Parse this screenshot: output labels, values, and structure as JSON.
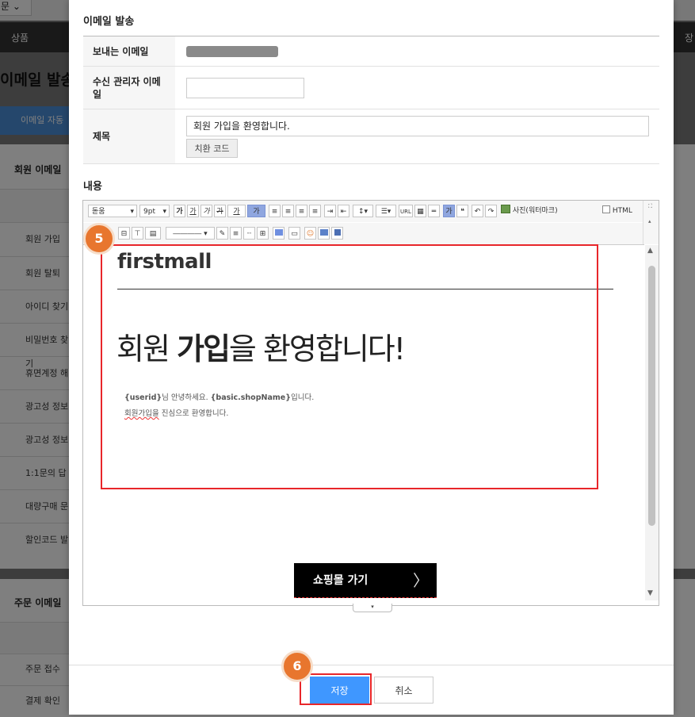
{
  "background": {
    "top_select": "문",
    "nav_left": "상품",
    "nav_right": "장",
    "page_title": "이메일 발송",
    "tab_label": "이메일 자동",
    "section1_title": "회원 이메일",
    "section1_rows": [
      "회원 가입",
      "회원 탈퇴",
      "아이디 찾기",
      "비밀번호 찾기",
      "휴면계정 해",
      "광고성 정보",
      "광고성 정보",
      "1:1문의 답",
      "대량구매 문",
      "할인코드 발"
    ],
    "section2_title": "주문 이메일",
    "section2_rows": [
      "주문 접수",
      "결제 확인"
    ]
  },
  "modal": {
    "title": "이메일 발송",
    "form": {
      "sender_label": "보내는 이메일",
      "recipient_label": "수신 관리자 이메일",
      "recipient_value": "",
      "subject_label": "제목",
      "subject_value": "회원 가입을 환영합니다.",
      "substitution_button": "치환 코드"
    },
    "content_label": "내용",
    "toolbar": {
      "font": "돋움",
      "size": "9pt",
      "bold": "가",
      "underline": "가",
      "italic": "가",
      "strike": "가",
      "text_color": "가",
      "bg_color": "가",
      "url": "URL",
      "photo": "사진(워터마크)",
      "html": "HTML"
    },
    "email_body": {
      "logo": "firstmall",
      "headline_pre": "회원 ",
      "headline_bold": "가입",
      "headline_post": "을 환영합니다!",
      "line1_var1": "{userid}",
      "line1_mid": "님 안녕하세요. ",
      "line1_var2": "{basic.shopName}",
      "line1_end": "입니다.",
      "line2_underlined": "회원가입을",
      "line2_rest": " 진심으로 환영합니다.",
      "shop_button": "쇼핑몰 가기",
      "shop_button_arrow": "〉"
    },
    "badges": {
      "editor_step": "5",
      "save_step": "6"
    },
    "footer": {
      "save": "저장",
      "cancel": "취소"
    },
    "colors": {
      "accent": "#3f97ff",
      "highlight": "#e8262a",
      "badge": "#e8762e"
    }
  }
}
